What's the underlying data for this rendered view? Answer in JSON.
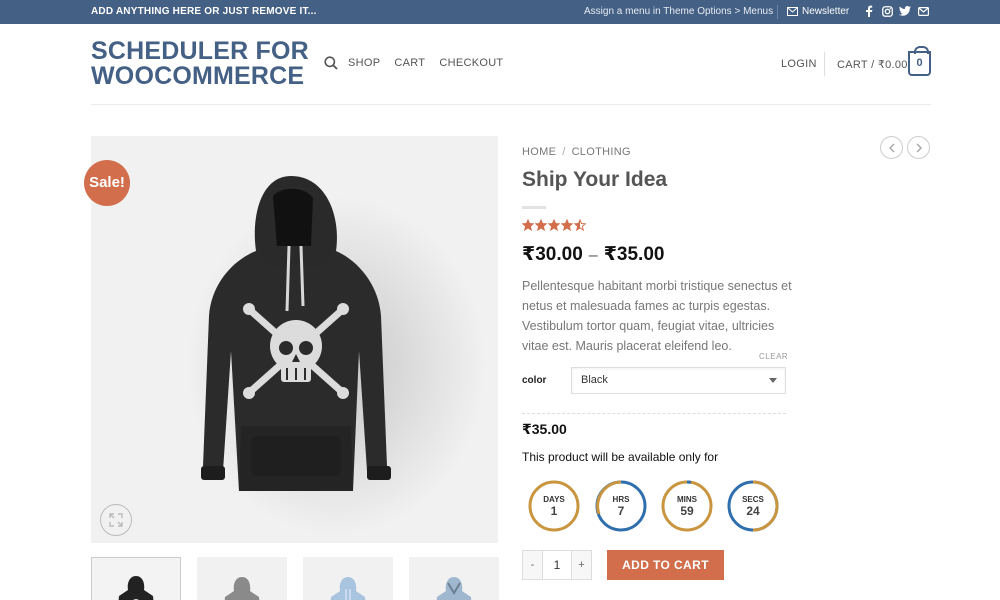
{
  "topbar": {
    "left_text": "ADD ANYTHING HERE OR JUST REMOVE IT...",
    "menu_note": "Assign a menu in Theme Options > Menus",
    "newsletter": "Newsletter",
    "socials": [
      "facebook-icon",
      "instagram-icon",
      "twitter-icon",
      "email-icon"
    ],
    "bg_color": "#446084"
  },
  "header": {
    "logo": "SCHEDULER FOR WOOCOMMERCE",
    "nav": [
      "SHOP",
      "CART",
      "CHECKOUT"
    ],
    "login": "LOGIN",
    "cart_label": "CART / ₹0.00",
    "cart_count": "0"
  },
  "gallery": {
    "sale_badge": "Sale!",
    "thumbnail_count": 4
  },
  "product": {
    "breadcrumb": [
      "HOME",
      "CLOTHING"
    ],
    "breadcrumb_divider": "/",
    "title": "Ship Your Idea",
    "rating": 4.5,
    "rating_max": 5,
    "price_low": "₹30.00",
    "price_range_dash": "–",
    "price_high": "₹35.00",
    "description": "Pellentesque habitant morbi tristique senectus et netus et malesuada fames ac turpis egestas. Vestibulum tortor quam, feugiat vitae, ultricies vitae est. Mauris placerat eleifend leo.",
    "clear_label": "CLEAR",
    "color_label": "color",
    "color_value": "Black",
    "variation_price": "₹35.00",
    "availability_text": "This product will be available only for",
    "countdown": [
      {
        "label": "DAYS",
        "value": "1"
      },
      {
        "label": "HRS",
        "value": "7"
      },
      {
        "label": "MINS",
        "value": "59"
      },
      {
        "label": "SECS",
        "value": "24"
      }
    ],
    "qty_minus": "-",
    "qty_value": "1",
    "qty_plus": "+",
    "add_to_cart": "ADD TO CART"
  },
  "colors": {
    "brand": "#446084",
    "accent": "#d26e4b",
    "star": "#d26e4b",
    "timer_gold": "#c9953f",
    "timer_blue": "#2f6fad"
  }
}
